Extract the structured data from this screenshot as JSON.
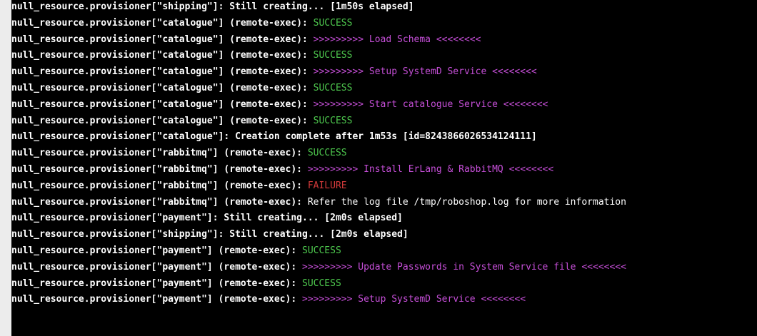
{
  "terminal": {
    "colors": {
      "background": "#000000",
      "text": "#ffffff",
      "success": "#4ec94e",
      "magenta": "#c64fd8",
      "failure": "#d23a3a"
    },
    "lines": [
      {
        "prefix": "null_resource.provisioner[\"shipping\"]: ",
        "message": "Still creating... [1m50s elapsed]",
        "style": "bold"
      },
      {
        "prefix": "null_resource.provisioner[\"catalogue\"] (remote-exec): ",
        "message": "SUCCESS",
        "style": "success"
      },
      {
        "prefix": "null_resource.provisioner[\"catalogue\"] (remote-exec): ",
        "message": ">>>>>>>>> Load Schema <<<<<<<<",
        "style": "magenta"
      },
      {
        "prefix": "null_resource.provisioner[\"catalogue\"] (remote-exec): ",
        "message": "SUCCESS",
        "style": "success"
      },
      {
        "prefix": "null_resource.provisioner[\"catalogue\"] (remote-exec): ",
        "message": ">>>>>>>>> Setup SystemD Service <<<<<<<<",
        "style": "magenta"
      },
      {
        "prefix": "null_resource.provisioner[\"catalogue\"] (remote-exec): ",
        "message": "SUCCESS",
        "style": "success"
      },
      {
        "prefix": "null_resource.provisioner[\"catalogue\"] (remote-exec): ",
        "message": ">>>>>>>>> Start catalogue Service <<<<<<<<",
        "style": "magenta"
      },
      {
        "prefix": "null_resource.provisioner[\"catalogue\"] (remote-exec): ",
        "message": "SUCCESS",
        "style": "success"
      },
      {
        "prefix": "null_resource.provisioner[\"catalogue\"]: ",
        "message": "Creation complete after 1m53s [id=8243866026534124111]",
        "style": "bold"
      },
      {
        "prefix": "null_resource.provisioner[\"rabbitmq\"] (remote-exec): ",
        "message": "SUCCESS",
        "style": "success"
      },
      {
        "prefix": "null_resource.provisioner[\"rabbitmq\"] (remote-exec): ",
        "message": ">>>>>>>>> Install ErLang & RabbitMQ <<<<<<<<",
        "style": "magenta"
      },
      {
        "prefix": "null_resource.provisioner[\"rabbitmq\"] (remote-exec): ",
        "message": "FAILURE",
        "style": "failure"
      },
      {
        "prefix": "null_resource.provisioner[\"rabbitmq\"] (remote-exec): ",
        "message": "Refer the log file /tmp/roboshop.log for more information",
        "style": "plain"
      },
      {
        "prefix": "null_resource.provisioner[\"payment\"]: ",
        "message": "Still creating... [2m0s elapsed]",
        "style": "bold"
      },
      {
        "prefix": "null_resource.provisioner[\"shipping\"]: ",
        "message": "Still creating... [2m0s elapsed]",
        "style": "bold"
      },
      {
        "prefix": "null_resource.provisioner[\"payment\"] (remote-exec): ",
        "message": "SUCCESS",
        "style": "success"
      },
      {
        "prefix": "null_resource.provisioner[\"payment\"] (remote-exec): ",
        "message": ">>>>>>>>> Update Passwords in System Service file <<<<<<<<",
        "style": "magenta"
      },
      {
        "prefix": "null_resource.provisioner[\"payment\"] (remote-exec): ",
        "message": "SUCCESS",
        "style": "success"
      },
      {
        "prefix": "null_resource.provisioner[\"payment\"] (remote-exec): ",
        "message": ">>>>>>>>> Setup SystemD Service <<<<<<<<",
        "style": "magenta"
      }
    ]
  }
}
